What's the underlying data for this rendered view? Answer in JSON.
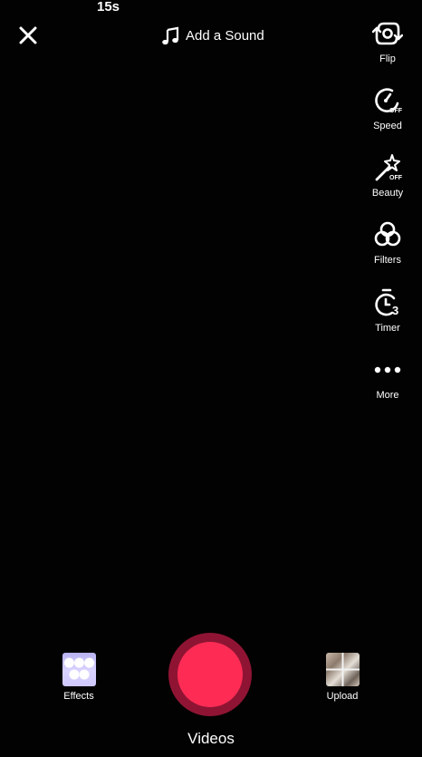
{
  "top_bar": {
    "duration": "15s",
    "sound_label": "Add a Sound"
  },
  "side_rail": {
    "items": [
      {
        "id": "flip",
        "label": "Flip",
        "icon": "flip-camera-icon"
      },
      {
        "id": "speed",
        "label": "Speed",
        "icon": "speed-off-icon"
      },
      {
        "id": "beauty",
        "label": "Beauty",
        "icon": "beauty-off-icon"
      },
      {
        "id": "filters",
        "label": "Filters",
        "icon": "filters-icon"
      },
      {
        "id": "timer",
        "label": "Timer",
        "icon": "timer-3-icon"
      },
      {
        "id": "more",
        "label": "More",
        "icon": "more-dots-icon"
      }
    ],
    "speed_badge": "OFF",
    "beauty_badge": "OFF",
    "timer_badge": "3"
  },
  "bottom_bar": {
    "effects_label": "Effects",
    "upload_label": "Upload",
    "mode_label": "Videos"
  },
  "colors": {
    "background": "#020202",
    "record_core": "#fe2c55",
    "record_ring": "#8f1433",
    "foreground": "#ffffff"
  }
}
